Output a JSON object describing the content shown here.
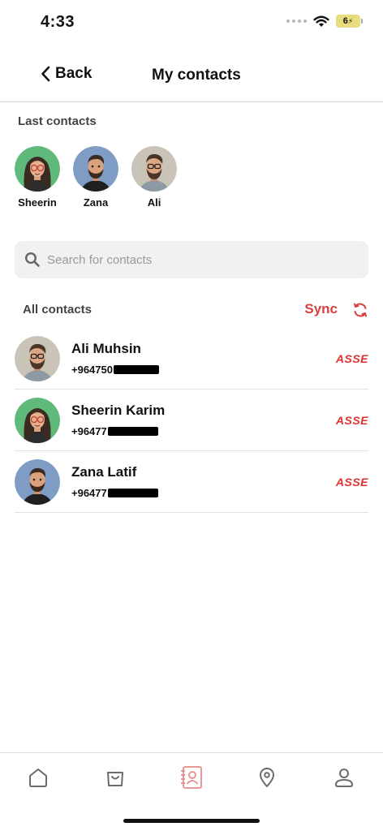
{
  "status_bar": {
    "time": "4:33",
    "battery": "6"
  },
  "header": {
    "back_label": "Back",
    "title": "My contacts"
  },
  "last_contacts": {
    "label": "Last contacts",
    "items": [
      {
        "name": "Sheerin",
        "avatar": "woman-glasses-avatar",
        "bg": "#5fb97b"
      },
      {
        "name": "Zana",
        "avatar": "man-beard-avatar",
        "bg": "#7f9cc4"
      },
      {
        "name": "Ali",
        "avatar": "man-glasses-beard-avatar",
        "bg": "#c9c3b8"
      }
    ]
  },
  "search": {
    "placeholder": "Search for contacts",
    "value": ""
  },
  "all_contacts": {
    "label": "All contacts",
    "sync_label": "Sync",
    "items": [
      {
        "name": "Ali Muhsin",
        "phone": "+964750",
        "badge": "ASSE",
        "avatar": "man-glasses-beard-avatar",
        "bg": "#c9c3b8"
      },
      {
        "name": "Sheerin Karim",
        "phone": "+96477",
        "badge": "ASSE",
        "avatar": "woman-glasses-avatar",
        "bg": "#5fb97b"
      },
      {
        "name": "Zana Latif",
        "phone": "+96477",
        "badge": "ASSE",
        "avatar": "man-beard-avatar",
        "bg": "#7f9cc4"
      }
    ]
  },
  "tab_bar": {
    "tabs": [
      {
        "icon": "home-icon",
        "active": false
      },
      {
        "icon": "shopping-bag-icon",
        "active": false
      },
      {
        "icon": "contacts-icon",
        "active": true
      },
      {
        "icon": "location-pin-icon",
        "active": false
      },
      {
        "icon": "profile-icon",
        "active": false
      }
    ]
  },
  "colors": {
    "accent": "#d9403f",
    "brand_badge": "#e0302f",
    "inactive_icon": "#6b6b6b",
    "active_icon": "#e88a8a"
  }
}
